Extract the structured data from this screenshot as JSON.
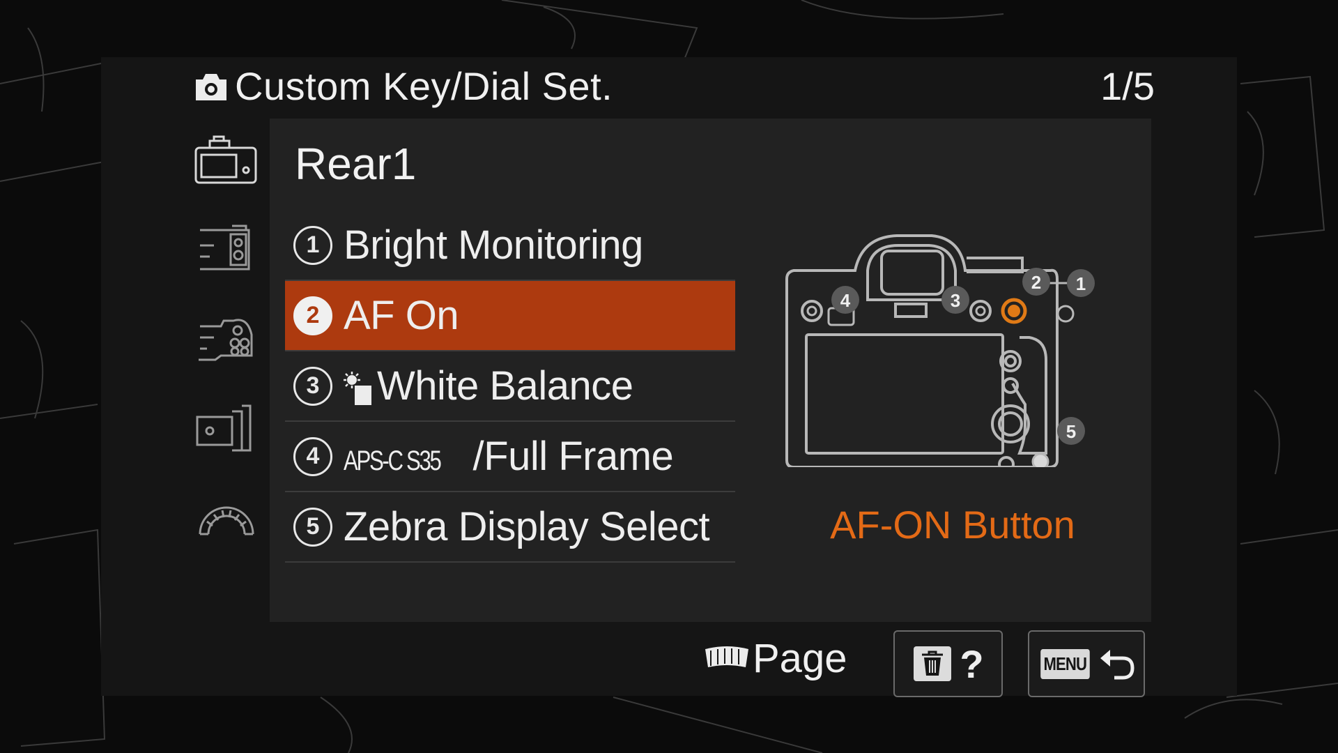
{
  "header": {
    "title": "Custom Key/Dial Set.",
    "page_indicator": "1/5",
    "title_icon": "camera-icon"
  },
  "tabs": [
    {
      "icon": "camera-body-rear-icon",
      "active": true
    },
    {
      "icon": "camera-body-side-icon",
      "active": false
    },
    {
      "icon": "camera-grip-buttons-icon",
      "active": false
    },
    {
      "icon": "lens-button-icon",
      "active": false
    },
    {
      "icon": "dial-icon",
      "active": false
    }
  ],
  "panel": {
    "group_name": "Rear1",
    "items": [
      {
        "number": "1",
        "label": "Bright Monitoring",
        "selected": false
      },
      {
        "number": "2",
        "label": "AF On",
        "selected": true
      },
      {
        "number": "3",
        "label": "White Balance",
        "prefix_icon": "white-balance-icon",
        "selected": false
      },
      {
        "number": "4",
        "prefix_text": "APS-C S35",
        "label": "/Full Frame",
        "selected": false
      },
      {
        "number": "5",
        "label": "Zebra Display Select",
        "selected": false
      }
    ],
    "diagram": {
      "callouts": [
        "1",
        "2",
        "3",
        "4",
        "5"
      ],
      "highlighted": "2",
      "highlight_color": "#e07a16"
    },
    "selected_button_name": "AF-ON Button"
  },
  "footer": {
    "page_hint": "Page",
    "page_hint_icon": "dial-icon",
    "help_button_icon": "trash-icon",
    "help_button_text": "?",
    "menu_chip": "MENU",
    "back_icon": "return-arrow-icon"
  },
  "colors": {
    "accent": "#ad3a0f",
    "highlight_text": "#e36a16",
    "panel": "#222222",
    "screen": "#151515"
  }
}
